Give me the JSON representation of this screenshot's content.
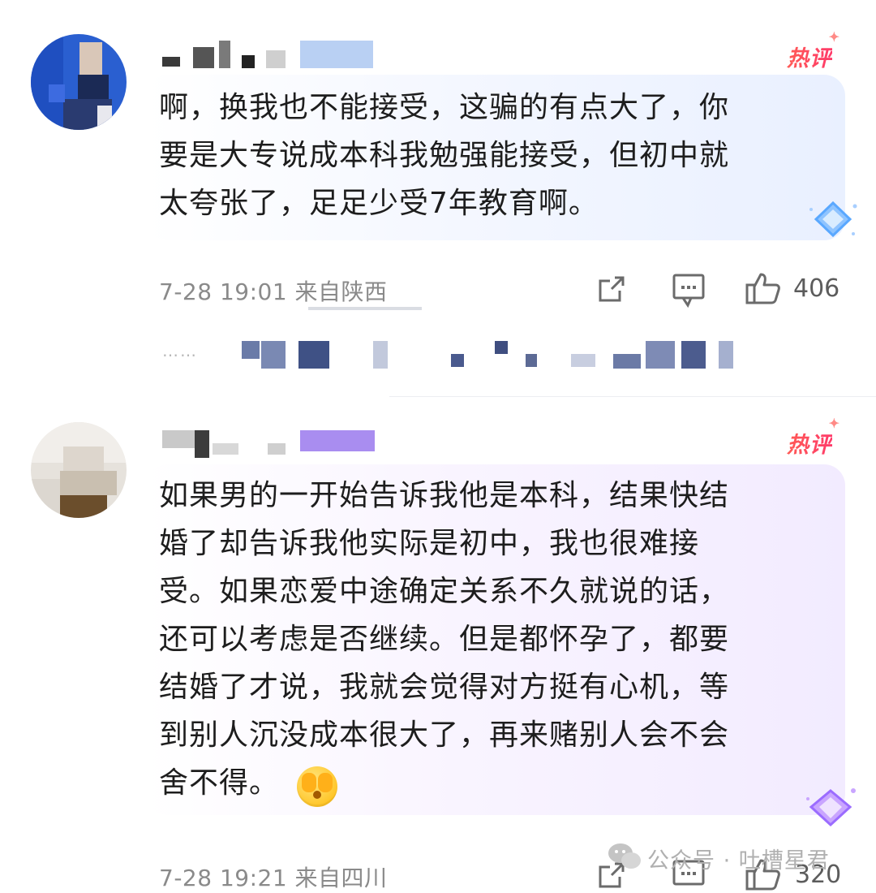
{
  "comments": [
    {
      "badge": "热评",
      "lines": [
        "啊，换我也不能接受，这骗的有点大了，你",
        "要是大专说成本科我勉强能接受，但初中就",
        "太夸张了，足足少受7年教育啊。"
      ],
      "meta": "7-28 19:01 来自陕西",
      "likes": "406"
    },
    {
      "badge": "热评",
      "lines": [
        "如果男的一开始告诉我他是本科，结果快结",
        "婚了却告诉我他实际是初中，我也很难接",
        "受。如果恋爱中途确定关系不久就说的话，",
        "还可以考虑是否继续。但是都怀孕了，都要",
        "结婚了才说，我就会觉得对方挺有心机，等",
        "到别人沉没成本很大了，再来赌别人会不会",
        "舍不得。"
      ],
      "meta": "7-28 19:21 来自四川",
      "likes": "320"
    }
  ],
  "reply_dots": "……",
  "watermark": "公众号 · 吐槽星君",
  "colors": {
    "hot_badge": "#ff4a5c",
    "meta_text": "#8a8a8a",
    "blue_bubble": "#e9f0ff",
    "purple_bubble": "#f2ebff"
  },
  "icons": [
    "share-icon",
    "comment-icon",
    "like-icon",
    "diamond-badge-icon",
    "hiding-face-emoji",
    "wechat-icon"
  ]
}
